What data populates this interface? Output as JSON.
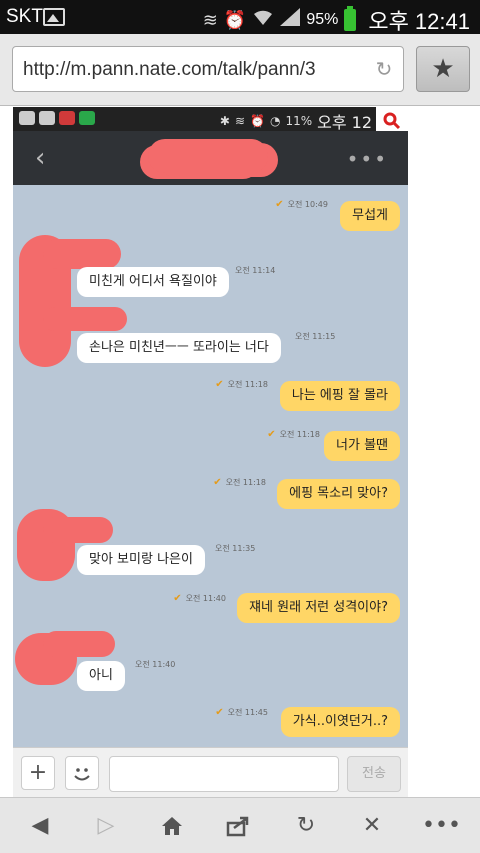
{
  "status_bar": {
    "carrier": "SKT",
    "battery_percent": "95%",
    "time": "오후 12:41"
  },
  "browser": {
    "url": "http://m.pann.nate.com/talk/pann/3",
    "bookmark_icon": "star-icon"
  },
  "screenshot": {
    "status": {
      "battery": "11%",
      "time": "오후 12"
    },
    "header": {
      "more_icon": "dots-icon"
    },
    "messages": [
      {
        "side": "me",
        "time": "오전 10:49",
        "text": "무섭게"
      },
      {
        "side": "them",
        "time": "오전 11:14",
        "text": "미친게 어디서 욕질이야"
      },
      {
        "side": "them",
        "time": "오전 11:15",
        "text": "손나은 미친년ㅡㅡ 또라이는 너다"
      },
      {
        "side": "me",
        "time": "오전 11:18",
        "text": "나는 에핑 잘 몰라"
      },
      {
        "side": "me",
        "time": "오전 11:18",
        "text": "너가 볼땐"
      },
      {
        "side": "me",
        "time": "오전 11:18",
        "text": "에핑 목소리 맞아?"
      },
      {
        "side": "them",
        "time": "오전 11:35",
        "text": "맞아 보미랑 나은이"
      },
      {
        "side": "me",
        "time": "오전 11:40",
        "text": "쟤네 원래 저런 성격이야?"
      },
      {
        "side": "them",
        "time": "오전 11:40",
        "text": "아니"
      },
      {
        "side": "me",
        "time": "오전 11:45",
        "text": "가식..이엿던거..?"
      }
    ],
    "input": {
      "plus": "+",
      "send_label": "전송"
    }
  }
}
